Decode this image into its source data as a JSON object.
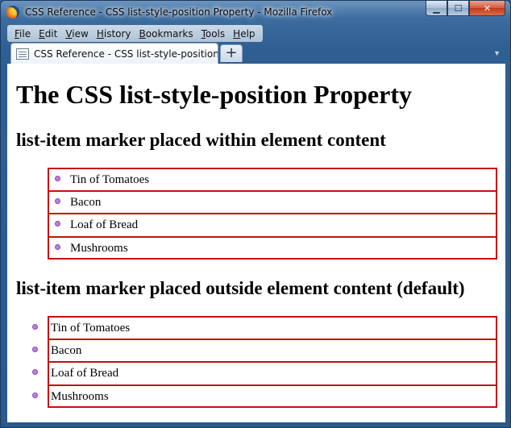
{
  "window": {
    "title": "CSS Reference - CSS list-style-position Property - Mozilla Firefox",
    "controls": {
      "minimize": "▁",
      "maximize": "☐",
      "close": "✕"
    }
  },
  "menu": [
    {
      "label": "File",
      "ul": "F",
      "rest": "ile"
    },
    {
      "label": "Edit",
      "ul": "E",
      "rest": "dit"
    },
    {
      "label": "View",
      "ul": "V",
      "rest": "iew"
    },
    {
      "label": "History",
      "ul": "H",
      "rest": "istory"
    },
    {
      "label": "Bookmarks",
      "ul": "B",
      "rest": "ookmarks"
    },
    {
      "label": "Tools",
      "ul": "T",
      "rest": "ools"
    },
    {
      "label": "Help",
      "ul": "H",
      "rest": "elp"
    }
  ],
  "tabs": {
    "active_label": "CSS Reference - CSS list-style-position P...",
    "new_tab": "+",
    "dropdown": "▼"
  },
  "page": {
    "title": "The CSS list-style-position Property",
    "inside_section": {
      "heading": "list-item marker placed within element content",
      "items": [
        "Tin of Tomatoes",
        "Bacon",
        "Loaf of Bread",
        "Mushrooms"
      ]
    },
    "outside_section": {
      "heading": "list-item marker placed outside element content (default)",
      "items": [
        "Tin of Tomatoes",
        "Bacon",
        "Loaf of Bread",
        "Mushrooms"
      ]
    }
  },
  "colors": {
    "list_border": "#c31010",
    "bullet": "#c07ce6"
  }
}
